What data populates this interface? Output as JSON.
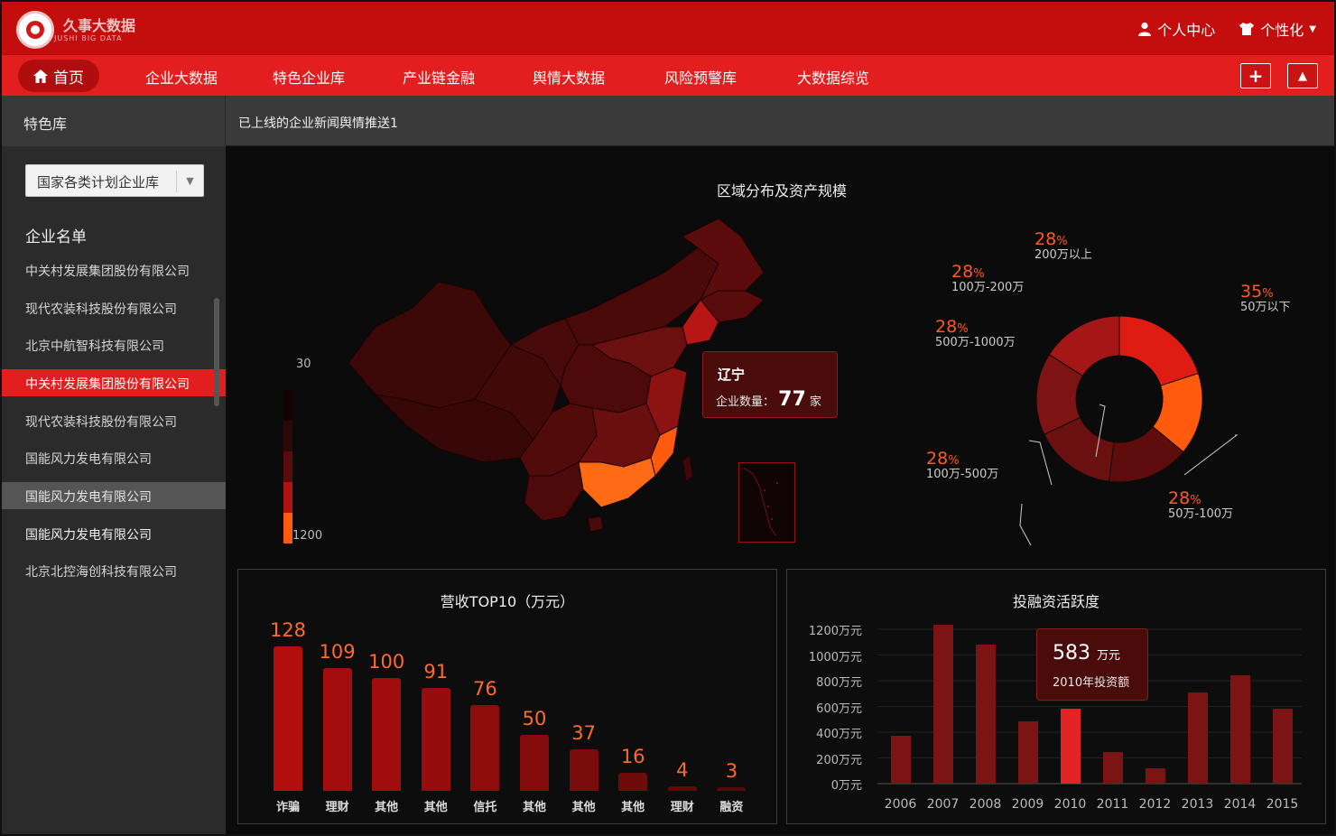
{
  "app": {
    "logo_text": "久事大数据",
    "logo_sub": "JUSHI BIG DATA"
  },
  "header": {
    "user_center": "个人中心",
    "personalize": "个性化"
  },
  "nav": {
    "home": "首页",
    "items": [
      "企业大数据",
      "特色企业库",
      "产业链金融",
      "舆情大数据",
      "风险预警库",
      "大数据综览"
    ],
    "add_btn": "+",
    "collapse_btn": "▲"
  },
  "subbar": {
    "section": "特色库",
    "news": "已上线的企业新闻舆情推送1"
  },
  "sidebar": {
    "select_value": "国家各类计划企业库",
    "list_title": "企业名单",
    "companies": [
      "中关村发展集团股份有限公司",
      "现代农装科技股份有限公司",
      "北京中航智科技有限公司",
      "中关村发展集团股份有限公司",
      "现代农装科技股份有限公司",
      "国能风力发电有限公司",
      "国能风力发电有限公司",
      "国能风力发电有限公司",
      "北京北控海创科技有限公司"
    ]
  },
  "map": {
    "title": "区域分布及资产规模",
    "legend_top": "30",
    "legend_bottom": "1200",
    "tooltip_region": "辽宁",
    "tooltip_label": "企业数量：",
    "tooltip_value": "77",
    "tooltip_unit": "家"
  },
  "donut": {
    "pct_unit": "%",
    "slices": [
      {
        "label": "50万以下",
        "pct": 35,
        "color": "#df1c14"
      },
      {
        "label": "50万-100万",
        "pct": 28,
        "color": "#ff5a0e"
      },
      {
        "label": "100万-500万",
        "pct": 28,
        "color": "#5e0c0c"
      },
      {
        "label": "500万-1000万",
        "pct": 28,
        "color": "#6a1010"
      },
      {
        "label": "100万-200万",
        "pct": 28,
        "color": "#7d1313"
      },
      {
        "label": "200万以上",
        "pct": 28,
        "color": "#a51616"
      }
    ]
  },
  "revenue": {
    "title": "营收TOP10（万元）",
    "categories": [
      "诈骗",
      "理财",
      "其他",
      "其他",
      "信托",
      "其他",
      "其他",
      "其他",
      "理财",
      "融资"
    ],
    "values": [
      128,
      109,
      100,
      91,
      76,
      50,
      37,
      16,
      4,
      3
    ]
  },
  "investment": {
    "title": "投融资活跃度",
    "years": [
      "2006",
      "2007",
      "2008",
      "2009",
      "2010",
      "2011",
      "2012",
      "2013",
      "2014",
      "2015"
    ],
    "values": [
      410,
      1360,
      1190,
      530,
      640,
      270,
      130,
      780,
      930,
      640
    ],
    "yticks": [
      "1200万元",
      "1000万元",
      "800万元",
      "600万元",
      "400万元",
      "200万元",
      "0万元"
    ],
    "highlight_index": 4,
    "tooltip_value": "583",
    "tooltip_unit": "万元",
    "tooltip_label": "2010年投资额"
  }
}
